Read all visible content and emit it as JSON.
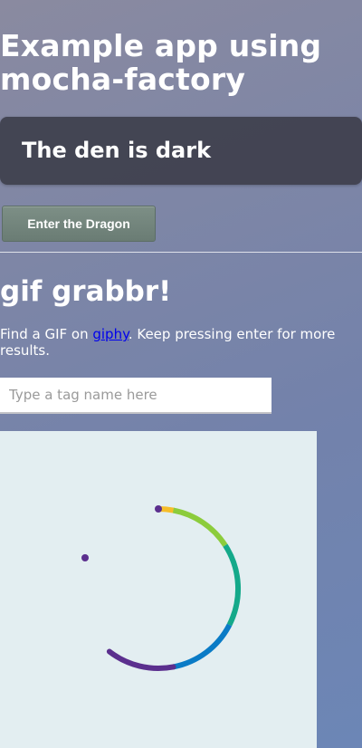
{
  "app": {
    "title": "Example app using mocha-factory"
  },
  "den": {
    "status_text": "The den is dark"
  },
  "dragon_button": {
    "label": "Enter the Dragon"
  },
  "gif_grabbr": {
    "title": "gif grabbr!",
    "intro_prefix": "Find a GIF on ",
    "link_text": "giphy",
    "intro_suffix": ". Keep pressing enter for more results."
  },
  "search": {
    "value": "",
    "placeholder": "Type a tag name here"
  },
  "loading": {
    "icon": "loading-spinner-icon",
    "colors": [
      "#f6bd2a",
      "#8ccc3c",
      "#14a98a",
      "#0a7bc6",
      "#5b2f8e"
    ]
  }
}
